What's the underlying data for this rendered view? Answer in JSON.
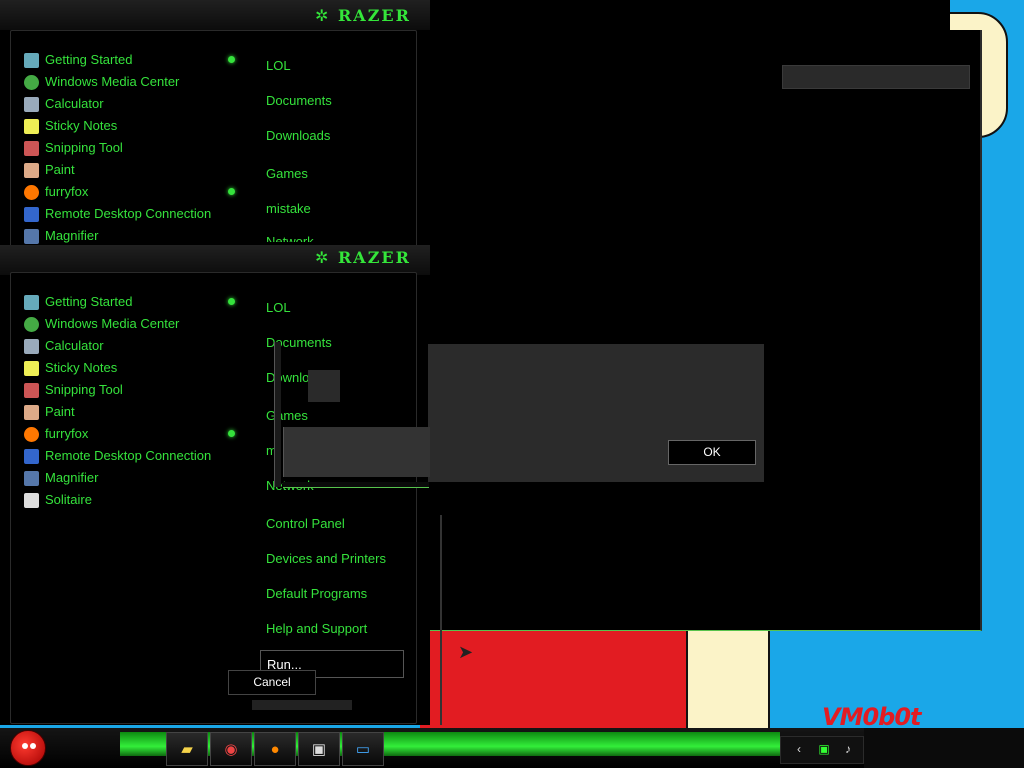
{
  "brand": {
    "name": "RAZER",
    "accent": "#35e23c"
  },
  "start_menu": {
    "programs": [
      {
        "label": "Getting Started",
        "icon": "getting-started-icon",
        "has_submenu": true
      },
      {
        "label": "Windows Media Center",
        "icon": "media-center-icon",
        "has_submenu": false
      },
      {
        "label": "Calculator",
        "icon": "calculator-icon",
        "has_submenu": false
      },
      {
        "label": "Sticky Notes",
        "icon": "sticky-notes-icon",
        "has_submenu": false
      },
      {
        "label": "Snipping Tool",
        "icon": "snipping-tool-icon",
        "has_submenu": false
      },
      {
        "label": "Paint",
        "icon": "paint-icon",
        "has_submenu": false
      },
      {
        "label": "furryfox",
        "icon": "firefox-icon",
        "has_submenu": true
      },
      {
        "label": "Remote Desktop Connection",
        "icon": "remote-desktop-icon",
        "has_submenu": false
      },
      {
        "label": "Magnifier",
        "icon": "magnifier-icon",
        "has_submenu": false
      },
      {
        "label": "Solitaire",
        "icon": "solitaire-icon",
        "has_submenu": false
      }
    ],
    "places": [
      "LOL",
      "Documents",
      "Downloads",
      "Games",
      "mistake",
      "Network",
      "Control Panel",
      "Devices and Printers",
      "Default Programs",
      "Help and Support"
    ],
    "places_partial": {
      "downloads": "Downlo",
      "games": "Games",
      "mistake": "m",
      "network_top": "Network"
    },
    "run_label": "Run...",
    "cancel_label": "Cancel"
  },
  "dialog": {
    "ok_label": "OK"
  },
  "taskbar": {
    "pinned": [
      "explorer-icon",
      "chrome-icon",
      "firefox-icon",
      "media-player-icon",
      "window-switch-icon"
    ],
    "tray": [
      "chevron-up-icon",
      "network-icon",
      "volume-icon"
    ]
  },
  "wallpaper": {
    "watermark": "VM0b0t"
  }
}
